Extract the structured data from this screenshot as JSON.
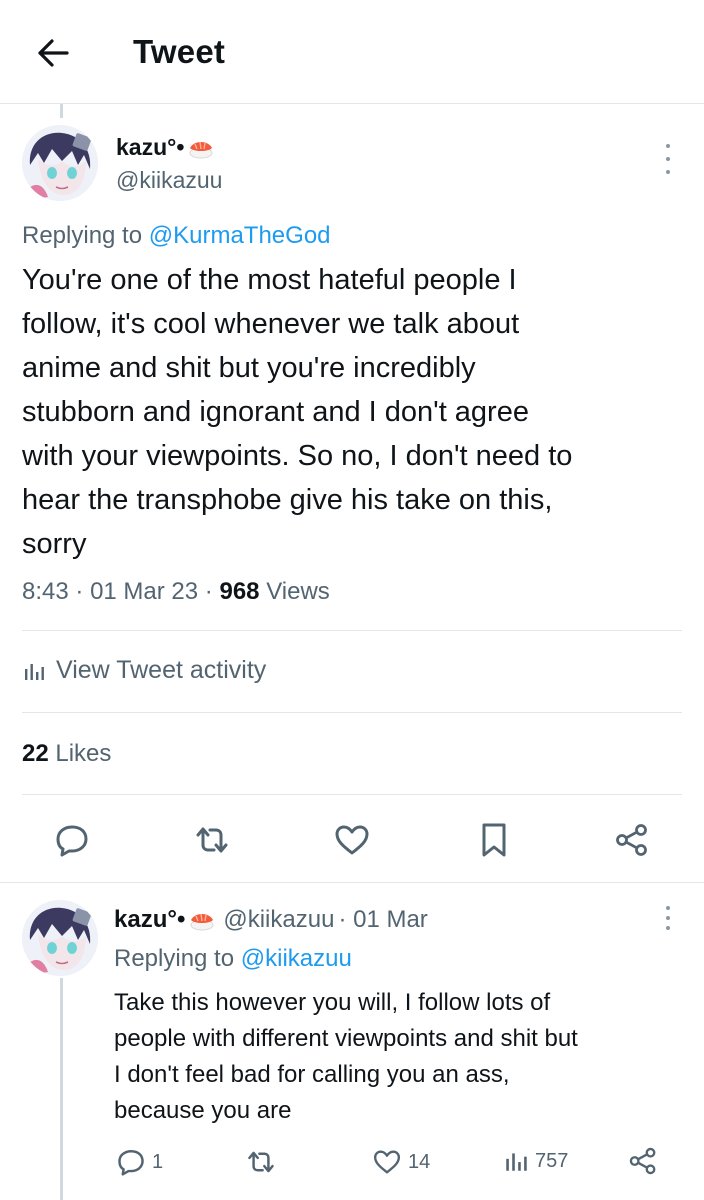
{
  "header": {
    "title": "Tweet",
    "back_icon": "arrow-left-icon"
  },
  "tweet": {
    "display_name": "kazu°•",
    "handle": "@kiikazuu",
    "replying_prefix": "Replying to",
    "replying_to": "@KurmaTheGod",
    "text_lines": [
      "You're one of the most hateful people I",
      "follow, it's cool whenever we talk about",
      "anime and shit but you're incredibly",
      "stubborn and ignorant and I don't agree",
      "with your viewpoints. So no, I don't need to",
      "hear the transphobe give his take on this,",
      "sorry"
    ],
    "time": "8:43",
    "date": "01 Mar 23",
    "views_count": "968",
    "views_label": "Views",
    "activity_label": "View Tweet activity",
    "likes_count": "22",
    "likes_label": "Likes"
  },
  "reply": {
    "display_name": "kazu°•",
    "handle": "@kiikazuu",
    "date": "· 01 Mar",
    "replying_prefix": "Replying to",
    "replying_to": "@kiikazuu",
    "text_lines": [
      "Take this however you will, I follow lots of",
      "people with different viewpoints and shit but",
      "I don't feel bad for calling you an ass,",
      "because you are"
    ],
    "reply_count": "1",
    "retweet_count": "",
    "like_count": "14",
    "views_count": "757"
  },
  "colors": {
    "link": "#1d9bf0",
    "secondary_text": "#536471",
    "primary_text": "#0f1419",
    "divider": "#e6e6e6"
  }
}
